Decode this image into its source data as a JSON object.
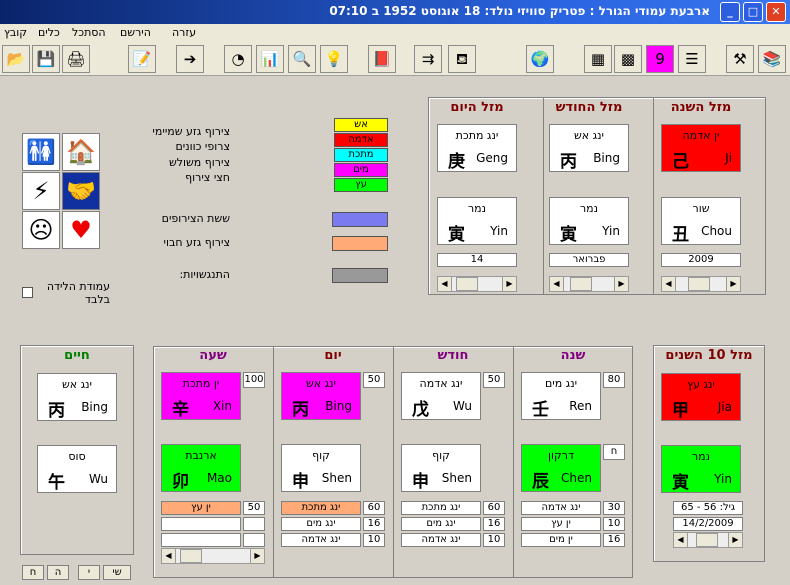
{
  "window": {
    "title": "ארבעת עמודי הגורל : פטריק סוויזי  נולד:  18 אוגוסט 1952 ב 07:10"
  },
  "menu": [
    "קובץ",
    "כלים",
    "הסתכל",
    "הירשם",
    "עזרה"
  ],
  "legend": {
    "rows": [
      {
        "label": "צירוף גזע שמיימי",
        "sw": "אש",
        "color": "#ffff00"
      },
      {
        "label": "צרופי כוונים",
        "sw": "אדמה",
        "color": "#ff0000"
      },
      {
        "label": "צירוף משולש",
        "sw": "מתכת",
        "color": "#00ffff"
      },
      {
        "label": "חצי צירוף",
        "sw": "מים",
        "color": "#ff00ff"
      },
      {
        "label": "",
        "sw": "עץ",
        "color": "#00ff00"
      }
    ],
    "six": "ששת הצירופים",
    "six_color": "#7b7bef",
    "friend": "צירוף גזע חבוי",
    "friend_color": "#ffaa77",
    "clash": "התנגשויות:",
    "clash_color": "#999999"
  },
  "birth_only": "עמודת הלידה בלבד",
  "top": [
    {
      "title": "מזל היום",
      "stem": {
        "name": "ינג מתכת",
        "ch": "庚",
        "py": "Geng",
        "color": "#ffffff"
      },
      "branch": {
        "name": "נמר",
        "ch": "寅",
        "py": "Yin",
        "color": "#ffffff"
      },
      "field": "14"
    },
    {
      "title": "מזל החודש",
      "stem": {
        "name": "ינג אש",
        "ch": "丙",
        "py": "Bing",
        "color": "#ffffff"
      },
      "branch": {
        "name": "נמר",
        "ch": "寅",
        "py": "Yin",
        "color": "#ffffff"
      },
      "field": "פברואר"
    },
    {
      "title": "מזל השנה",
      "stem": {
        "name": "ין אדמה",
        "ch": "己",
        "py": "Ji",
        "color": "#ff0000"
      },
      "branch": {
        "name": "שור",
        "ch": "丑",
        "py": "Chou",
        "color": "#ffffff"
      },
      "field": "2009"
    }
  ],
  "life": {
    "title": "חיים",
    "stem": {
      "name": "ינג אש",
      "ch": "丙",
      "py": "Bing"
    },
    "branch": {
      "name": "סוס",
      "ch": "午",
      "py": "Wu"
    }
  },
  "pillars": [
    {
      "title": "שעה",
      "num": "100",
      "stem": {
        "name": "ין מתכת",
        "ch": "辛",
        "py": "Xin",
        "color": "#ff00ff"
      },
      "branch": {
        "name": "ארנבת",
        "ch": "卯",
        "py": "Mao",
        "color": "#00ff00"
      },
      "bnum": "",
      "rows": [
        {
          "t": "ין עץ",
          "v": "50",
          "c": "#ffaa77"
        },
        {
          "t": "",
          "v": "",
          "c": "#ffffff"
        },
        {
          "t": "",
          "v": "",
          "c": "#ffffff"
        }
      ],
      "title_color": "#800080"
    },
    {
      "title": "יום",
      "num": "50",
      "stem": {
        "name": "ינג אש",
        "ch": "丙",
        "py": "Bing",
        "color": "#ff00ff"
      },
      "branch": {
        "name": "קוף",
        "ch": "申",
        "py": "Shen",
        "color": "#ffffff"
      },
      "bnum": "",
      "rows": [
        {
          "t": "ינג מתכת",
          "v": "60",
          "c": "#ffaa77"
        },
        {
          "t": "ינג מים",
          "v": "16",
          "c": "#ffffff"
        },
        {
          "t": "ינג אדמה",
          "v": "10",
          "c": "#ffffff"
        }
      ],
      "title_color": "#800000"
    },
    {
      "title": "חודש",
      "num": "50",
      "stem": {
        "name": "ינג אדמה",
        "ch": "戊",
        "py": "Wu",
        "color": "#ffffff"
      },
      "branch": {
        "name": "קוף",
        "ch": "申",
        "py": "Shen",
        "color": "#ffffff"
      },
      "bnum": "",
      "rows": [
        {
          "t": "ינג מתכת",
          "v": "60",
          "c": "#ffffff"
        },
        {
          "t": "ינג מים",
          "v": "16",
          "c": "#ffffff"
        },
        {
          "t": "ינג אדמה",
          "v": "10",
          "c": "#ffffff"
        }
      ],
      "title_color": "#800080"
    },
    {
      "title": "שנה",
      "num": "80",
      "stem": {
        "name": "ינג מים",
        "ch": "壬",
        "py": "Ren",
        "color": "#ffffff"
      },
      "branch": {
        "name": "דרקון",
        "ch": "辰",
        "py": "Chen",
        "color": "#00ff00"
      },
      "bnum": "ח",
      "rows": [
        {
          "t": "ינג אדמה",
          "v": "30",
          "c": "#ffffff"
        },
        {
          "t": "ין עץ",
          "v": "10",
          "c": "#ffffff"
        },
        {
          "t": "ין מים",
          "v": "16",
          "c": "#ffffff"
        }
      ],
      "title_color": "#800080"
    }
  ],
  "decade": {
    "title": "מזל 10 השנים",
    "stem": {
      "name": "ינג עץ",
      "ch": "甲",
      "py": "Jia",
      "color": "#ff0000"
    },
    "branch": {
      "name": "נמר",
      "ch": "寅",
      "py": "Yin",
      "color": "#00ff00"
    },
    "age": "גיל: 56 - 65",
    "date": "14/2/2009"
  },
  "bottom_buttons": [
    "ח",
    "ה",
    "י",
    "שי"
  ],
  "icons": [
    "couple-icon",
    "house-car-icon",
    "lightning-icon",
    "handshake-icon",
    "sad-face-icon",
    "heart-icon"
  ]
}
